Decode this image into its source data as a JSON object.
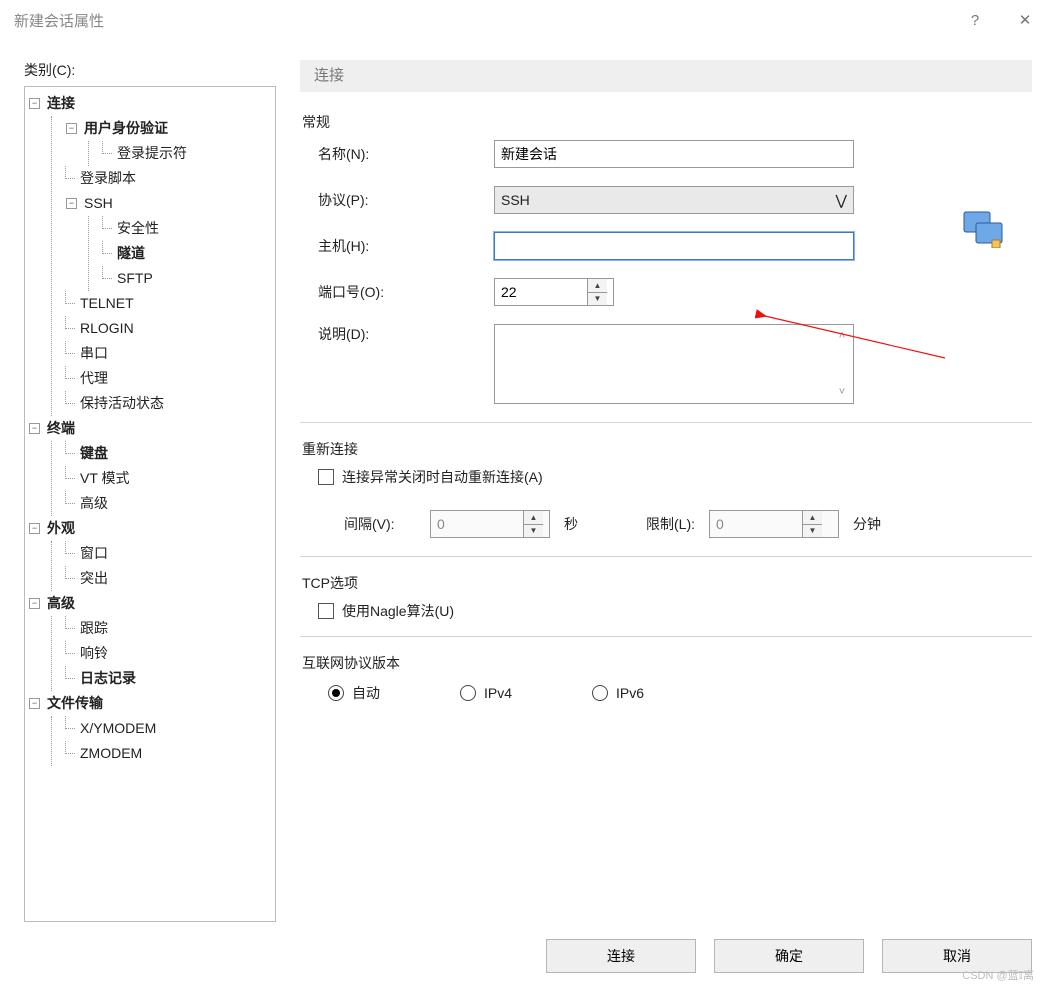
{
  "window": {
    "title": "新建会话属性",
    "help_icon": "?",
    "close_icon": "✕"
  },
  "category_label": "类别(C):",
  "tree": {
    "connection": "连接",
    "user_auth": "用户身份验证",
    "login_prompt": "登录提示符",
    "login_script": "登录脚本",
    "ssh": "SSH",
    "security": "安全性",
    "tunnel": "隧道",
    "sftp": "SFTP",
    "telnet": "TELNET",
    "rlogin": "RLOGIN",
    "serial": "串口",
    "proxy": "代理",
    "keep_alive": "保持活动状态",
    "terminal": "终端",
    "keyboard": "键盘",
    "vt_mode": "VT 模式",
    "advanced_term": "高级",
    "appearance": "外观",
    "window": "窗口",
    "highlight": "突出",
    "advanced": "高级",
    "trace": "跟踪",
    "bell": "响铃",
    "logging": "日志记录",
    "file_transfer": "文件传输",
    "xymodem": "X/YMODEM",
    "zmodem": "ZMODEM"
  },
  "panel": {
    "header": "连接",
    "general_title": "常规",
    "name_label": "名称(N):",
    "name_value": "新建会话",
    "protocol_label": "协议(P):",
    "protocol_value": "SSH",
    "host_label": "主机(H):",
    "host_value": "",
    "port_label": "端口号(O):",
    "port_value": "22",
    "desc_label": "说明(D):",
    "reconnect_title": "重新连接",
    "reconnect_checkbox": "连接异常关闭时自动重新连接(A)",
    "interval_label": "间隔(V):",
    "interval_value": "0",
    "seconds": "秒",
    "limit_label": "限制(L):",
    "limit_value": "0",
    "minutes": "分钟",
    "tcp_title": "TCP选项",
    "nagle_checkbox": "使用Nagle算法(U)",
    "ip_title": "互联网协议版本",
    "ip_auto": "自动",
    "ip_v4": "IPv4",
    "ip_v6": "IPv6"
  },
  "buttons": {
    "connect": "连接",
    "ok": "确定",
    "cancel": "取消"
  },
  "watermark": "CSDN @蓝𝕀离"
}
